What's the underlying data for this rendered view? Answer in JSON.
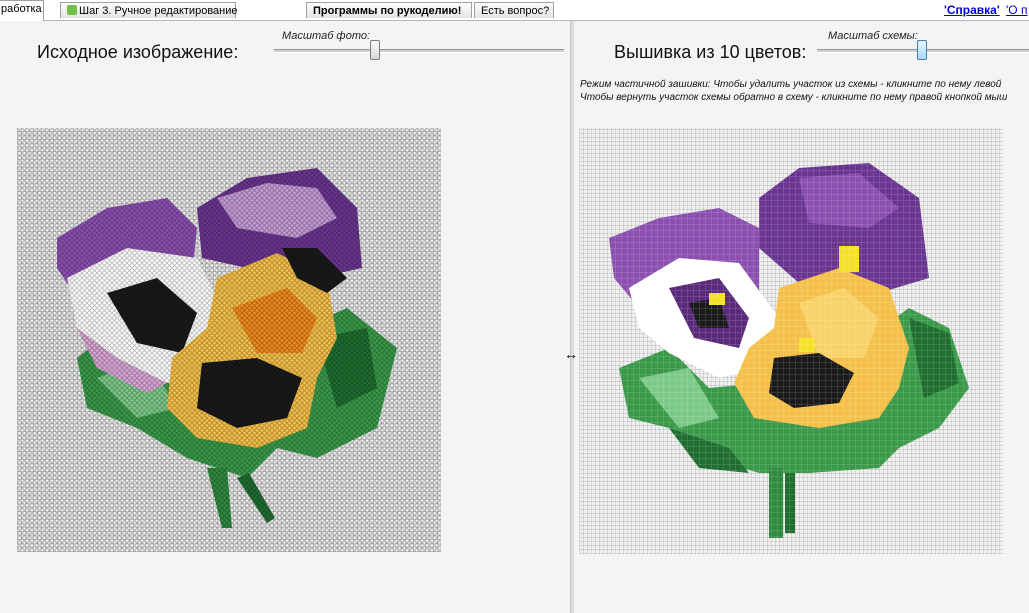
{
  "tabs": [
    {
      "label": "работка",
      "active": true
    },
    {
      "label": "Шаг 3. Ручное редактирование",
      "active": false
    },
    {
      "label": "Программы по рукоделию!",
      "active": false
    },
    {
      "label": "Есть вопрос?",
      "active": false
    }
  ],
  "links": {
    "help": "'Справка'",
    "about": "'О п"
  },
  "left": {
    "heading": "Исходное изображение:",
    "scale_label": "Масштаб фото:",
    "slider_value": 0.2
  },
  "right": {
    "heading": "Вышивка из 10 цветов:",
    "scale_label": "Масштаб схемы:",
    "slider_value": 0.1,
    "hint_line1": "Режим частичной зашивки: Чтобы удалить участок из схемы - кликните по нему левой",
    "hint_line2": "Чтобы вернуть участок схемы обратно в схему - кликните по нему правой кнопкой мыш"
  },
  "icons": {
    "tab_icon": "edit-icon",
    "resize_cursor": "resize-horizontal-icon"
  },
  "colors": {
    "purple_dark": "#5a2a7a",
    "purple": "#8b4fb0",
    "purple_light": "#c39bd6",
    "yellow": "#f5c04a",
    "orange": "#f08a1e",
    "green": "#3a9a4a",
    "green_dark": "#1f6e30",
    "black": "#1a1a1a",
    "white": "#ffffff"
  }
}
